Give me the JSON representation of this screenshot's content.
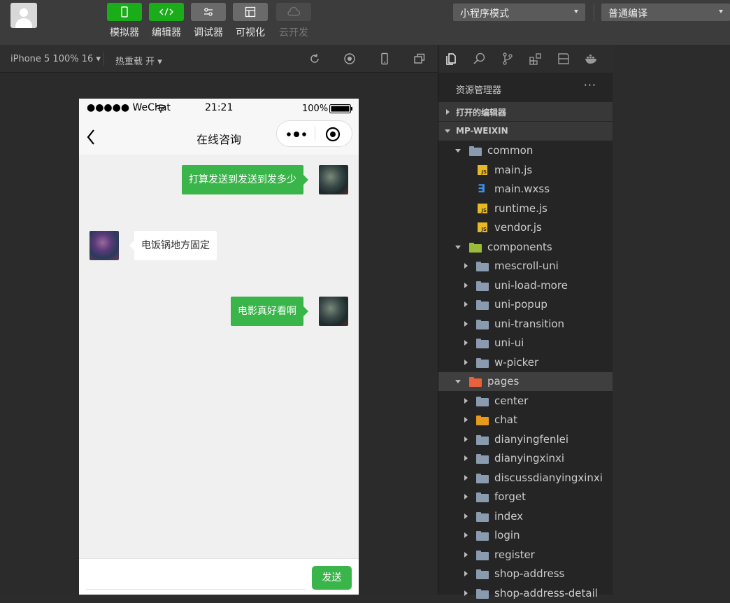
{
  "toolbar": {
    "tools": [
      {
        "label": "模拟器",
        "state": "active"
      },
      {
        "label": "编辑器",
        "state": "active"
      },
      {
        "label": "调试器",
        "state": "normal"
      },
      {
        "label": "可视化",
        "state": "normal"
      },
      {
        "label": "云开发",
        "state": "disabled"
      }
    ],
    "mode_select": "小程序模式",
    "compile_select": "普通编译"
  },
  "simbar": {
    "device": "iPhone 5 100% 16 ▾",
    "hot_reload": "热重载 开 ▾"
  },
  "phone": {
    "status": {
      "carrier": "●●●●● WeChat",
      "time": "21:21",
      "battery": "100%"
    },
    "nav_title": "在线咨询",
    "messages": [
      {
        "from": "me",
        "text": "打算发送到发送到发多少"
      },
      {
        "from": "other",
        "text": "电饭锅地方固定"
      },
      {
        "from": "me",
        "text": "电影真好看啊"
      }
    ],
    "send_label": "发送"
  },
  "explorer": {
    "title": "资源管理器",
    "more": "···",
    "open_editors": "打开的编辑器",
    "project": "MP-WEIXIN",
    "tree": [
      {
        "label": "common",
        "type": "folder-open"
      },
      {
        "label": "main.js",
        "type": "js"
      },
      {
        "label": "main.wxss",
        "type": "css"
      },
      {
        "label": "runtime.js",
        "type": "js"
      },
      {
        "label": "vendor.js",
        "type": "js"
      },
      {
        "label": "components",
        "type": "folder-open-special"
      },
      {
        "label": "mescroll-uni",
        "type": "folder"
      },
      {
        "label": "uni-load-more",
        "type": "folder"
      },
      {
        "label": "uni-popup",
        "type": "folder"
      },
      {
        "label": "uni-transition",
        "type": "folder"
      },
      {
        "label": "uni-ui",
        "type": "folder"
      },
      {
        "label": "w-picker",
        "type": "folder"
      },
      {
        "label": "pages",
        "type": "folder-open-pages"
      },
      {
        "label": "center",
        "type": "folder"
      },
      {
        "label": "chat",
        "type": "folder-chat"
      },
      {
        "label": "dianyingfenlei",
        "type": "folder"
      },
      {
        "label": "dianyingxinxi",
        "type": "folder"
      },
      {
        "label": "discussdianyingxinxi",
        "type": "folder"
      },
      {
        "label": "forget",
        "type": "folder"
      },
      {
        "label": "index",
        "type": "folder"
      },
      {
        "label": "login",
        "type": "folder"
      },
      {
        "label": "register",
        "type": "folder"
      },
      {
        "label": "shop-address",
        "type": "folder"
      },
      {
        "label": "shop-address-detail",
        "type": "folder"
      }
    ]
  }
}
